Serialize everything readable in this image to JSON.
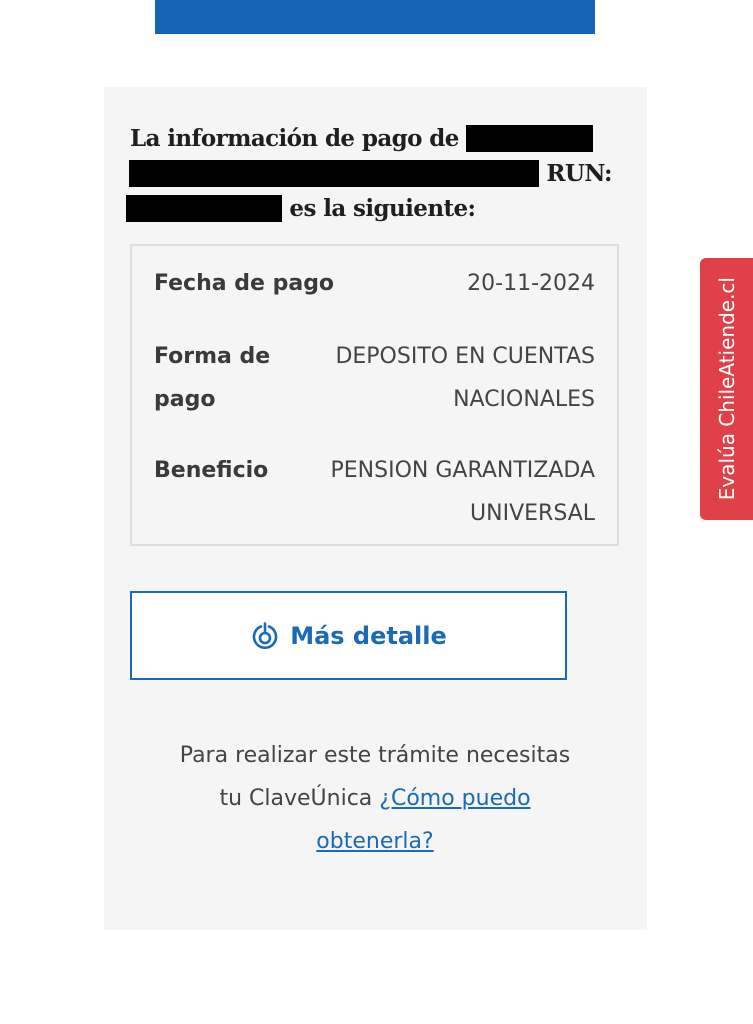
{
  "heading": {
    "part1": "La información de pago de",
    "part2": "RUN:",
    "part3": "es la siguiente:"
  },
  "payment_info": {
    "fecha": {
      "label": "Fecha de pago",
      "value": "20-11-2024"
    },
    "forma": {
      "label_line1": "Forma de",
      "label_line2": "pago",
      "value_line1": "DEPOSITO EN CUENTAS",
      "value_line2": "NACIONALES"
    },
    "beneficio": {
      "label": "Beneficio",
      "value_line1": "PENSION GARANTIZADA",
      "value_line2": "UNIVERSAL"
    }
  },
  "detail_button": {
    "label": "Más detalle",
    "icon": "clave-unica-icon"
  },
  "footer": {
    "line1": "Para realizar este trámite necesitas",
    "line2_text": "tu ClaveÚnica",
    "link_line1": "¿Cómo puedo",
    "link_line2": "obtenerla?"
  },
  "side_tab": {
    "label": "Evalúa ChileAtiende.cl"
  },
  "colors": {
    "primary": "#1565b4",
    "link": "#1b6ab8",
    "tab": "#e04149",
    "panel": "#f5f5f5"
  }
}
